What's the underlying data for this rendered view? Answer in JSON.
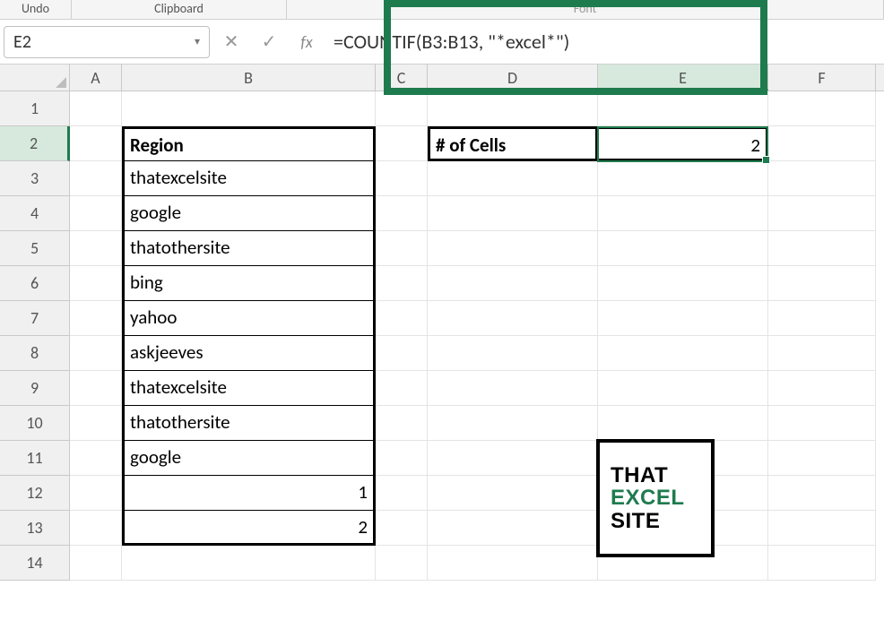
{
  "ribbon": {
    "undo": "Undo",
    "clipboard": "Clipboard",
    "font": "Font"
  },
  "namebox": {
    "value": "E2"
  },
  "formula": {
    "value": "=COUNTIF(B3:B13, \"*excel*\")"
  },
  "columns": [
    "A",
    "B",
    "C",
    "D",
    "E",
    "F"
  ],
  "rows": [
    "1",
    "2",
    "3",
    "4",
    "5",
    "6",
    "7",
    "8",
    "9",
    "10",
    "11",
    "12",
    "13",
    "14"
  ],
  "table": {
    "header": "Region",
    "items": [
      "thatexcelsite",
      "google",
      "thatothersite",
      "bing",
      "yahoo",
      "askjeeves",
      "thatexcelsite",
      "thatothersite",
      "google",
      "1",
      "2"
    ]
  },
  "result": {
    "label": "# of Cells",
    "value": "2"
  },
  "logo": {
    "l1": "THAT",
    "l2": "EXCEL",
    "l3": "SITE"
  },
  "active_cell": "E2",
  "selected_col": "E",
  "selected_row": "2"
}
